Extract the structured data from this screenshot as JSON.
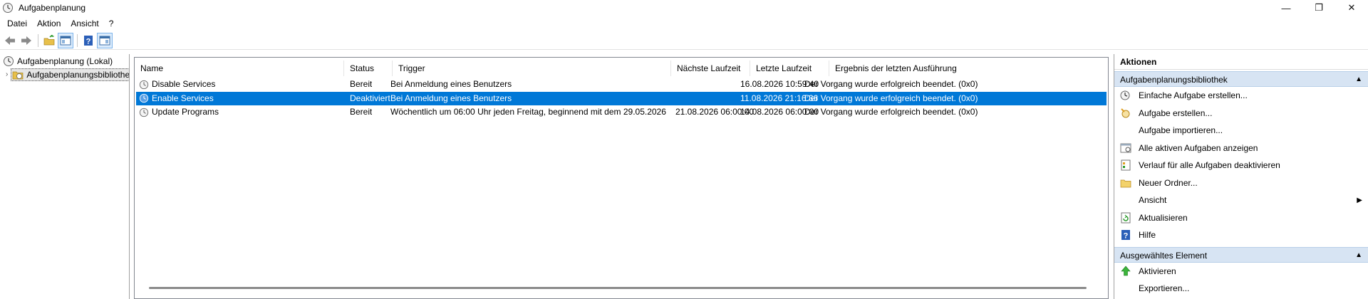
{
  "window": {
    "title": "Aufgabenplanung",
    "controls": {
      "minimize": "—",
      "maximize": "❐",
      "close": "✕"
    }
  },
  "menu": [
    "Datei",
    "Aktion",
    "Ansicht",
    "?"
  ],
  "toolbar": {
    "buttons": [
      "back-icon",
      "forward-icon",
      "folder-up-icon",
      "show-hide-console-tree-icon",
      "help-icon",
      "show-hide-action-pane-icon"
    ]
  },
  "tree": {
    "root": "Aufgabenplanung (Lokal)",
    "child": "Aufgabenplanungsbibliothek"
  },
  "columns": {
    "name": "Name",
    "status": "Status",
    "trigger": "Trigger",
    "next": "Nächste Laufzeit",
    "last": "Letzte Laufzeit",
    "result": "Ergebnis der letzten Ausführung"
  },
  "tasks": [
    {
      "name": "Disable Services",
      "status": "Bereit",
      "trigger": "Bei Anmeldung eines Benutzers",
      "next": "",
      "last": "16.08.2026 10:59:40",
      "result": "Der Vorgang wurde erfolgreich beendet. (0x0)"
    },
    {
      "name": "Enable Services",
      "status": "Deaktiviert",
      "trigger": "Bei Anmeldung eines Benutzers",
      "next": "",
      "last": "11.08.2026 21:16:36",
      "result": "Der Vorgang wurde erfolgreich beendet. (0x0)"
    },
    {
      "name": "Update Programs",
      "status": "Bereit",
      "trigger": "Wöchentlich um 06:00 Uhr jeden Freitag, beginnend mit dem 29.05.2026",
      "next": "21.08.2026 06:00:00",
      "last": "14.08.2026 06:00:00",
      "result": "Der Vorgang wurde erfolgreich beendet. (0x0)"
    }
  ],
  "selected_task_index": 1,
  "actions": {
    "title": "Aktionen",
    "library_section": "Aufgabenplanungsbibliothek",
    "library_items": [
      "Einfache Aufgabe erstellen...",
      "Aufgabe erstellen...",
      "Aufgabe importieren...",
      "Alle aktiven Aufgaben anzeigen",
      "Verlauf für alle Aufgaben deaktivieren",
      "Neuer Ordner...",
      "Ansicht",
      "Aktualisieren",
      "Hilfe"
    ],
    "selected_section": "Ausgewähltes Element",
    "selected_items": [
      "Aktivieren",
      "Exportieren..."
    ]
  },
  "colors": {
    "selection": "#0078d7",
    "section_header": "#d7e4f3"
  }
}
